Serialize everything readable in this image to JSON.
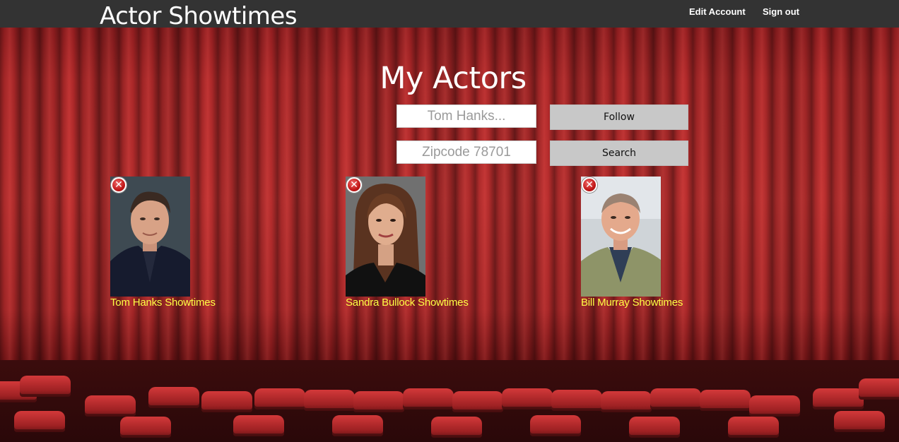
{
  "header": {
    "brand": "Actor Showtimes",
    "nav": {
      "edit_account": "Edit Account",
      "sign_out": "Sign out"
    }
  },
  "main": {
    "title": "My Actors",
    "actor_input": {
      "placeholder": "Tom Hanks..."
    },
    "zip_input": {
      "placeholder": "Zipcode 78701"
    },
    "follow_label": "Follow",
    "search_label": "Search",
    "actors": [
      {
        "name": "Tom Hanks",
        "link": "Tom Hanks Showtimes"
      },
      {
        "name": "Sandra Bullock",
        "link": "Sandra Bullock Showtimes"
      },
      {
        "name": "Bill Murray",
        "link": "Bill Murray Showtimes"
      }
    ]
  },
  "icons": {
    "remove": "remove-icon"
  },
  "colors": {
    "topbar": "#333333",
    "caption": "#ffff44",
    "button": "#c8c8c8",
    "curtain": "#b72a2b"
  }
}
